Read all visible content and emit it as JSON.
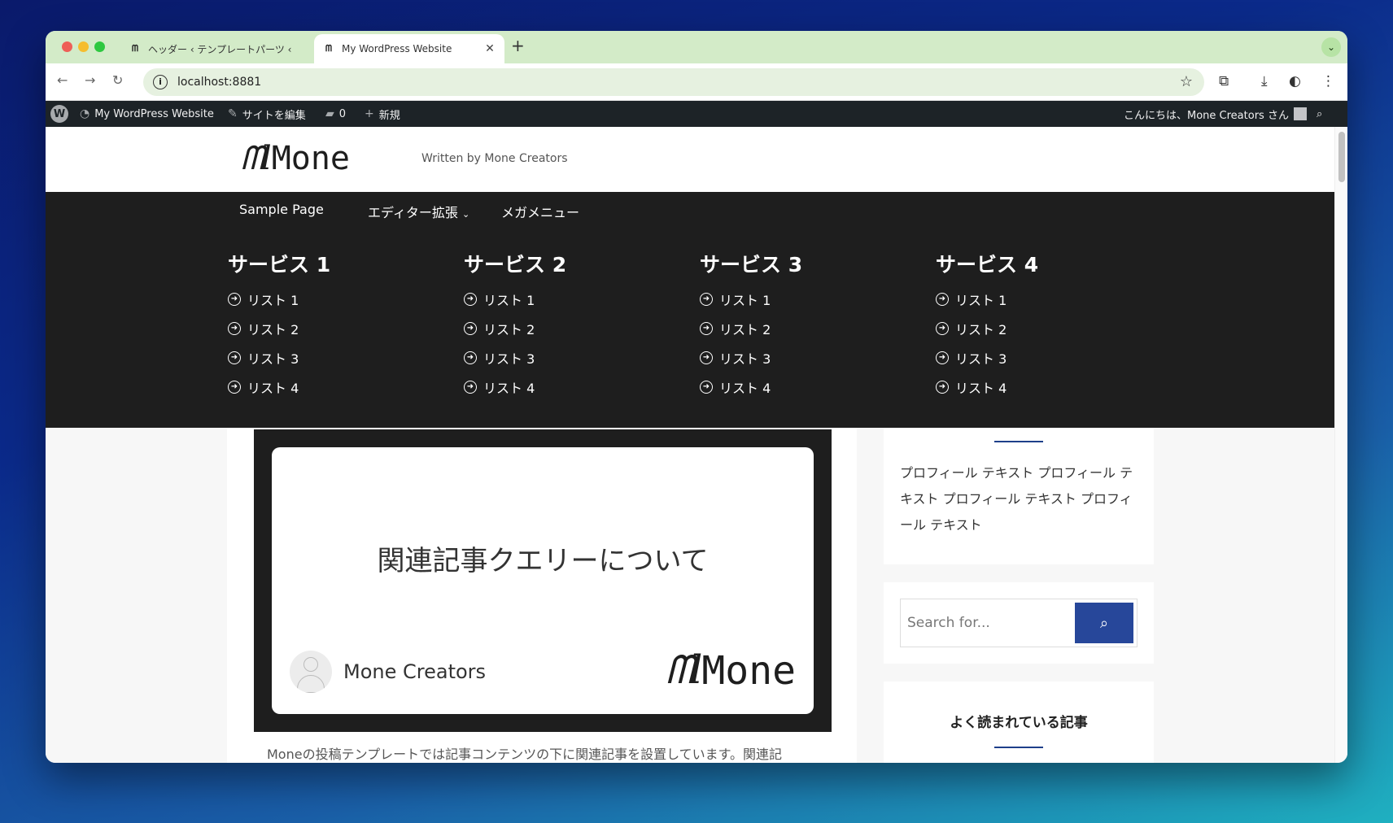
{
  "browser": {
    "tabs": [
      {
        "title": "ヘッダー ‹ テンプレートパーツ ‹",
        "favicon": "mone-icon"
      },
      {
        "title": "My WordPress Website",
        "favicon": "mone-icon"
      }
    ],
    "url": "localhost:8881"
  },
  "adminbar": {
    "site_name": "My WordPress Website",
    "edit_site": "サイトを編集",
    "comments_count": "0",
    "new": "新規",
    "greeting": "こんにちは、Mone Creators さん"
  },
  "header": {
    "logo_text": "Mone",
    "tagline": "Written by Mone Creators"
  },
  "nav": {
    "items": [
      "Sample Page",
      "エディター拡張",
      "メガメニュー"
    ]
  },
  "megamenu": [
    {
      "title": "サービス 1",
      "items": [
        "リスト 1",
        "リスト 2",
        "リスト 3",
        "リスト 4"
      ]
    },
    {
      "title": "サービス 2",
      "items": [
        "リスト 1",
        "リスト 2",
        "リスト 3",
        "リスト 4"
      ]
    },
    {
      "title": "サービス 3",
      "items": [
        "リスト 1",
        "リスト 2",
        "リスト 3",
        "リスト 4"
      ]
    },
    {
      "title": "サービス 4",
      "items": [
        "リスト 1",
        "リスト 2",
        "リスト 3",
        "リスト 4"
      ]
    }
  ],
  "post": {
    "featured_title": "関連記事クエリーについて",
    "author": "Mone Creators",
    "logo_text": "Mone",
    "excerpt": "Moneの投稿テンプレートでは記事コンテンツの下に関連記事を設置しています。関連記"
  },
  "sidebar": {
    "profile_text": "プロフィール テキスト プロフィール テキスト プロフィール テキスト プロフィール テキスト",
    "search_placeholder": "Search for...",
    "popular_title": "よく読まれている記事"
  },
  "colors": {
    "accent": "#27479a",
    "nav_bg": "#1e1e1e",
    "adminbar_bg": "#1d2327"
  }
}
